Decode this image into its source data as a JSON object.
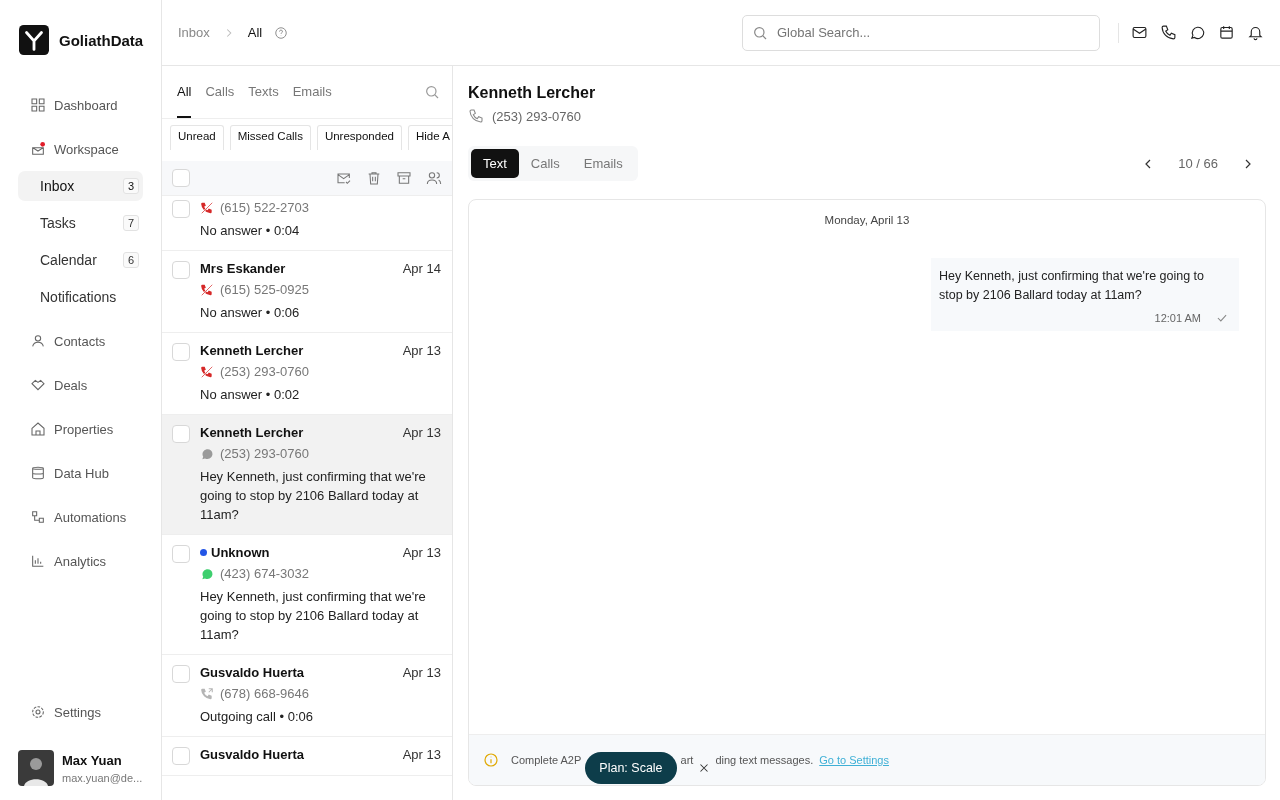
{
  "brand": {
    "name": "GoliathData"
  },
  "sidebar": {
    "items": [
      {
        "label": "Dashboard"
      },
      {
        "label": "Workspace",
        "alert": true,
        "children": [
          {
            "label": "Inbox",
            "count": "3",
            "selected": true
          },
          {
            "label": "Tasks",
            "count": "7",
            "selected": false
          },
          {
            "label": "Calendar",
            "count": "6",
            "selected": false
          },
          {
            "label": "Notifications",
            "selected": false
          }
        ]
      },
      {
        "label": "Contacts"
      },
      {
        "label": "Deals"
      },
      {
        "label": "Properties"
      },
      {
        "label": "Data Hub"
      },
      {
        "label": "Automations"
      },
      {
        "label": "Analytics"
      }
    ],
    "settings": "Settings",
    "user": {
      "name": "Max Yuan",
      "email": "max.yuan@de..."
    }
  },
  "breadcrumb": [
    "Inbox",
    "All"
  ],
  "search": {
    "placeholder": "Global Search..."
  },
  "inbox": {
    "tabs": [
      {
        "label": "All",
        "selected": true
      },
      {
        "label": "Calls",
        "selected": false
      },
      {
        "label": "Texts",
        "selected": false
      },
      {
        "label": "Emails",
        "selected": false
      }
    ],
    "filters": [
      "Unread",
      "Missed Calls",
      "Unresponded",
      "Hide A"
    ],
    "select_all": {
      "checked": false
    },
    "items": [
      {
        "kind": "missed_call",
        "phone": "(615) 522-2703",
        "preview": "No answer • 0:04",
        "selected": false,
        "checked": false
      },
      {
        "kind": "missed_call",
        "name": "Mrs Eskander",
        "date": "Apr 14",
        "phone": "(615) 525-0925",
        "preview": "No answer • 0:06",
        "selected": false,
        "unread": false,
        "checked": false
      },
      {
        "kind": "missed_call",
        "name": "Kenneth Lercher",
        "date": "Apr 13",
        "phone": "(253) 293-0760",
        "preview": "No answer • 0:02",
        "selected": false,
        "unread": false,
        "checked": false
      },
      {
        "kind": "text",
        "name": "Kenneth Lercher",
        "date": "Apr 13",
        "phone": "(253) 293-0760",
        "preview": "Hey Kenneth, just confirming that we're going to stop by 2106 Ballard today at 11am?",
        "selected": true,
        "unread": false,
        "checked": false
      },
      {
        "kind": "text",
        "name": "Unknown",
        "date": "Apr 13",
        "phone": "(423) 674-3032",
        "preview": "Hey Kenneth, just confirming that we're going to stop by 2106 Ballard today at 11am?",
        "selected": false,
        "unread": true,
        "checked": false
      },
      {
        "kind": "outgoing_call",
        "name": "Gusvaldo Huerta",
        "date": "Apr 13",
        "phone": "(678) 668-9646",
        "preview": "Outgoing call • 0:06",
        "selected": false,
        "unread": false,
        "checked": false
      },
      {
        "name": "Gusvaldo Huerta",
        "date": "Apr 13",
        "selected": false,
        "unread": false,
        "checked": false
      }
    ]
  },
  "contact": {
    "name": "Kenneth Lercher",
    "phone": "(253) 293-0760"
  },
  "conversation": {
    "tabs": [
      {
        "label": "Text",
        "selected": true
      },
      {
        "label": "Calls",
        "selected": false
      },
      {
        "label": "Emails",
        "selected": false
      }
    ],
    "pager": "10 / 66",
    "day": "Monday, April 13",
    "messages": [
      {
        "text": "Hey Kenneth, just confirming that we're going to stop by 2106 Ballard today at 11am?",
        "time": "12:01 AM",
        "delivered": true
      }
    ],
    "banner": {
      "parts": [
        "Complete A2P",
        "art",
        "ding text messages."
      ],
      "link": "Go to Settings"
    },
    "toast": "Plan: Scale"
  }
}
